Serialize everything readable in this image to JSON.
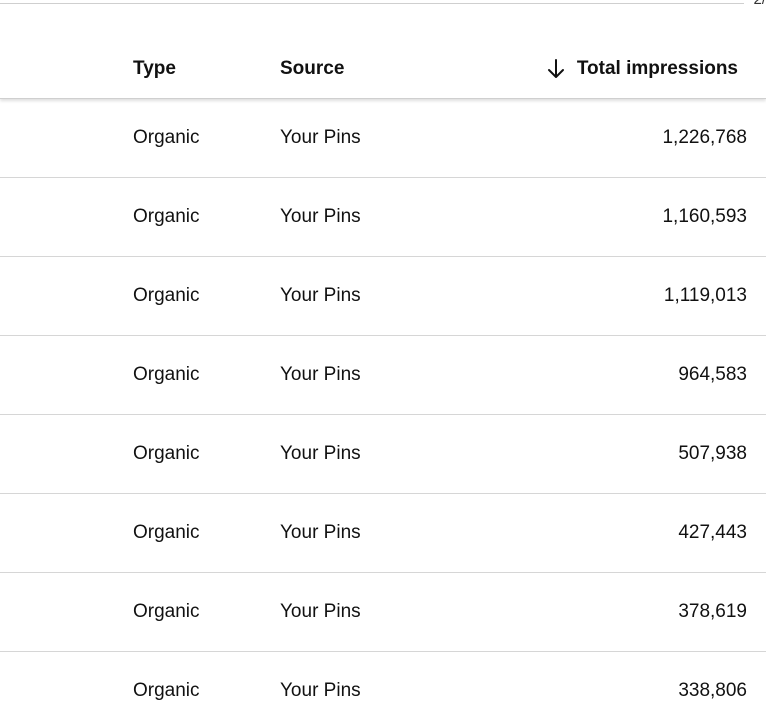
{
  "header": {
    "corner_fragment": "2/",
    "columns": {
      "type": "Type",
      "source": "Source",
      "total": "Total impressions"
    },
    "sort_icon": "arrow-down-icon"
  },
  "rows": [
    {
      "type": "Organic",
      "source": "Your Pins",
      "total": "1,226,768"
    },
    {
      "type": "Organic",
      "source": "Your Pins",
      "total": "1,160,593"
    },
    {
      "type": "Organic",
      "source": "Your Pins",
      "total": "1,119,013"
    },
    {
      "type": "Organic",
      "source": "Your Pins",
      "total": "964,583"
    },
    {
      "type": "Organic",
      "source": "Your Pins",
      "total": "507,938"
    },
    {
      "type": "Organic",
      "source": "Your Pins",
      "total": "427,443"
    },
    {
      "type": "Organic",
      "source": "Your Pins",
      "total": "378,619"
    },
    {
      "type": "Organic",
      "source": "Your Pins",
      "total": "338,806"
    }
  ]
}
